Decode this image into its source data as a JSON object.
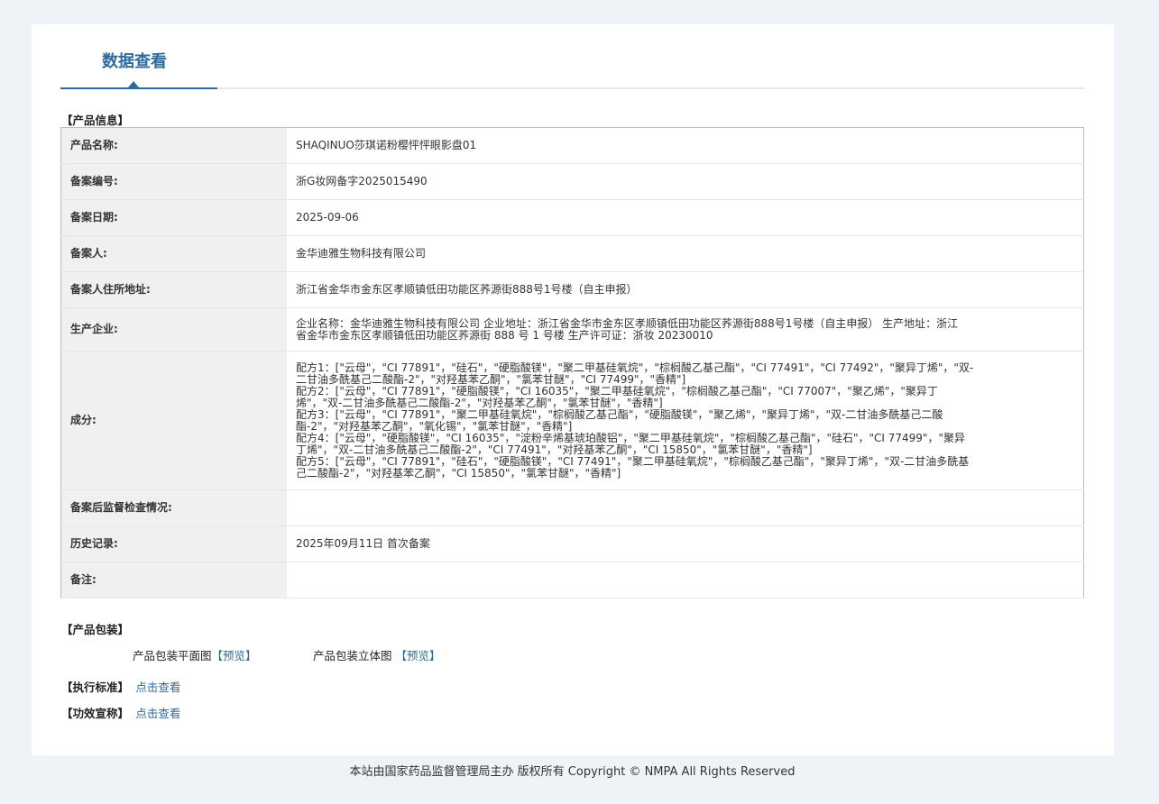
{
  "tab": {
    "title": "数据查看"
  },
  "product_info": {
    "section_title": "【产品信息】",
    "rows": [
      {
        "label": "产品名称:",
        "value": "SHAQINUO莎琪诺粉樱怦怦眼影盘01"
      },
      {
        "label": "备案编号:",
        "value": "浙G妆网备字2025015490"
      },
      {
        "label": "备案日期:",
        "value": "2025-09-06"
      },
      {
        "label": "备案人:",
        "value": "金华迪雅生物科技有限公司"
      },
      {
        "label": "备案人住所地址:",
        "value": "浙江省金华市金东区孝顺镇低田功能区荞源街888号1号楼（自主申报）"
      },
      {
        "label": "生产企业:",
        "lines": [
          "企业名称：金华迪雅生物科技有限公司 企业地址：浙江省金华市金东区孝顺镇低田功能区荞源街888号1号楼（自主申报） 生产地址：浙江",
          "省金华市金东区孝顺镇低田功能区荞源街 888 号 1 号楼 生产许可证：浙妆 20230010"
        ]
      },
      {
        "label": "成分:",
        "lines": [
          "配方1：[\"云母\"，\"CI 77891\"，\"硅石\"，\"硬脂酸镁\"，\"聚二甲基硅氧烷\"，\"棕榈酸乙基己酯\"，\"CI 77491\"，\"CI 77492\"，\"聚异丁烯\"，\"双-",
          "二甘油多酰基己二酸酯-2\"，\"对羟基苯乙酮\"，\"氯苯甘醚\"，\"CI 77499\"，\"香精\"]",
          "配方2：[\"云母\"，\"CI 77891\"，\"硬脂酸镁\"，\"CI 16035\"，\"聚二甲基硅氧烷\"，\"棕榈酸乙基己酯\"，\"CI 77007\"，\"聚乙烯\"，\"聚异丁",
          "烯\"，\"双-二甘油多酰基己二酸酯-2\"，\"对羟基苯乙酮\"，\"氯苯甘醚\"，\"香精\"]",
          "配方3：[\"云母\"，\"CI 77891\"，\"聚二甲基硅氧烷\"，\"棕榈酸乙基己酯\"，\"硬脂酸镁\"，\"聚乙烯\"，\"聚异丁烯\"，\"双-二甘油多酰基己二酸",
          "酯-2\"，\"对羟基苯乙酮\"，\"氧化锡\"，\"氯苯甘醚\"，\"香精\"]",
          "配方4：[\"云母\"，\"硬脂酸镁\"，\"CI 16035\"，\"淀粉辛烯基琥珀酸铝\"，\"聚二甲基硅氧烷\"，\"棕榈酸乙基己酯\"，\"硅石\"，\"CI 77499\"，\"聚异",
          "丁烯\"，\"双-二甘油多酰基己二酸酯-2\"，\"CI 77491\"，\"对羟基苯乙酮\"，\"CI 15850\"，\"氯苯甘醚\"，\"香精\"]",
          "配方5：[\"云母\"，\"CI 77891\"，\"硅石\"，\"硬脂酸镁\"，\"CI 77491\"，\"聚二甲基硅氧烷\"，\"棕榈酸乙基己酯\"，\"聚异丁烯\"，\"双-二甘油多酰基",
          "己二酸酯-2\"，\"对羟基苯乙酮\"，\"CI 15850\"，\"氯苯甘醚\"，\"香精\"]"
        ]
      },
      {
        "label": "备案后监督检查情况:",
        "value": ""
      },
      {
        "label": "历史记录:",
        "value": "2025年09月11日 首次备案"
      },
      {
        "label": "备注:",
        "value": ""
      }
    ]
  },
  "packaging": {
    "section_title": "【产品包装】",
    "flat_label": "产品包装平面图",
    "flat_link": "【预览】",
    "solid_label": "产品包装立体图",
    "solid_link": "【预览】"
  },
  "standard": {
    "section_title": "【执行标准】",
    "link": "点击查看"
  },
  "efficacy": {
    "section_title": "【功效宣称】",
    "link": "点击查看"
  },
  "footer": {
    "text": "本站由国家药品监督管理局主办 版权所有 Copyright © NMPA All Rights Reserved"
  }
}
